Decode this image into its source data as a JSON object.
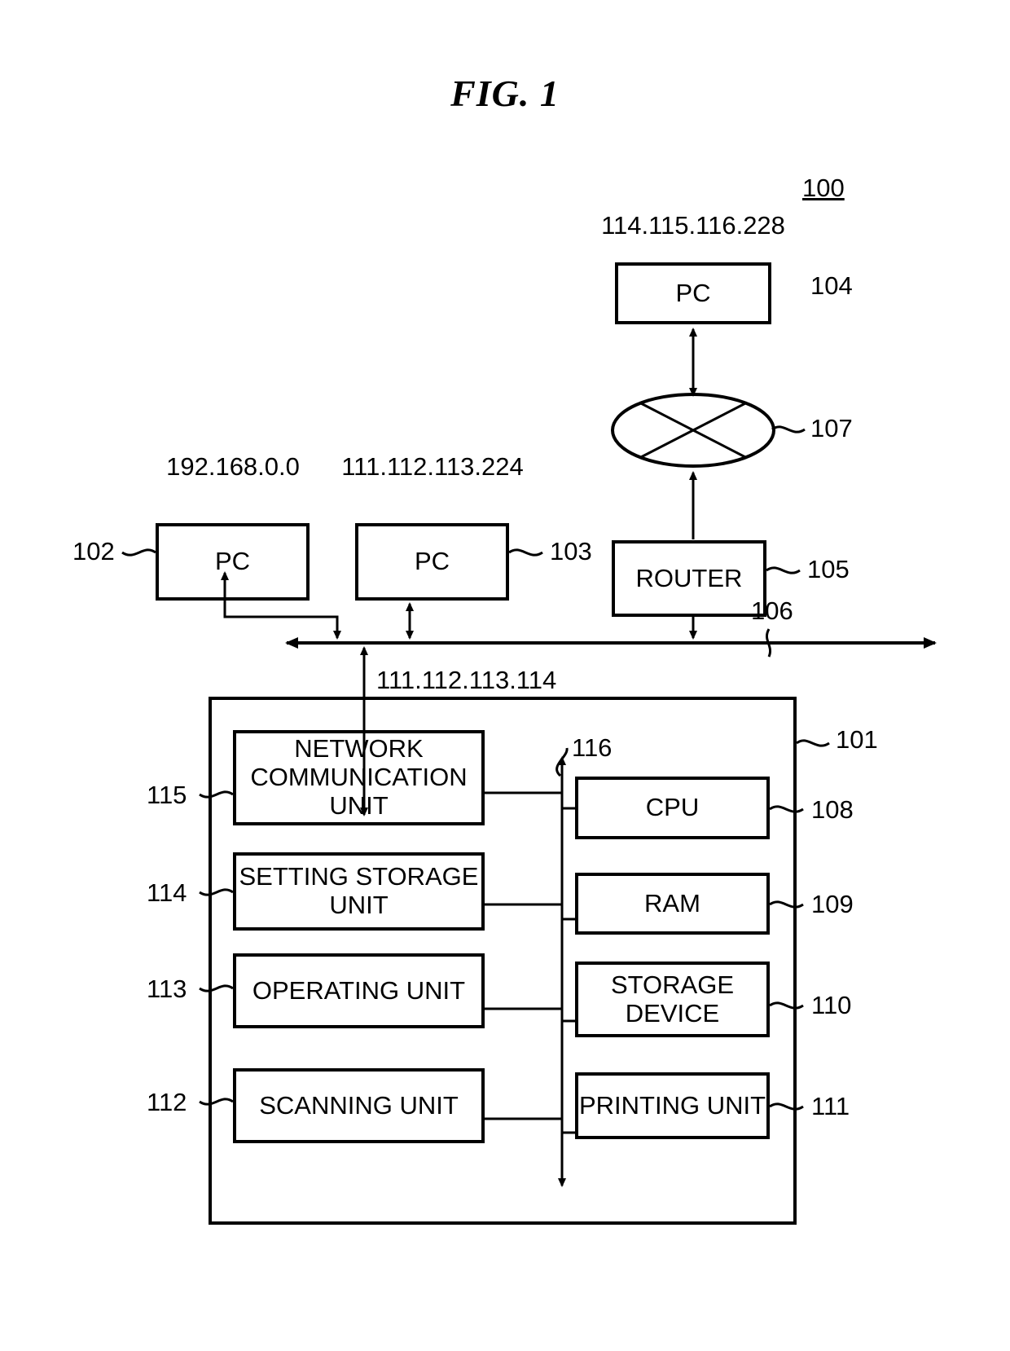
{
  "figure": {
    "title": "FIG. 1",
    "system_ref": "100"
  },
  "network": {
    "internet_cloud": {
      "ref": "107",
      "icon": "network-cloud-ellipse-x"
    },
    "bus": {
      "ref": "106",
      "icon": "bidirectional-bus-arrow"
    },
    "nodes": [
      {
        "id": "pc-104",
        "label": "PC",
        "ref": "104",
        "ip": "114.115.116.228"
      },
      {
        "id": "pc-102",
        "label": "PC",
        "ref": "102",
        "ip": "192.168.0.0"
      },
      {
        "id": "pc-103",
        "label": "PC",
        "ref": "103",
        "ip": "111.112.113.224"
      },
      {
        "id": "router-105",
        "label": "ROUTER",
        "ref": "105",
        "ip": ""
      }
    ]
  },
  "device": {
    "ref": "101",
    "ip": "111.112.113.114",
    "internal_bus": {
      "ref": "116",
      "icon": "internal-bus-arrow"
    },
    "left_units": [
      {
        "id": "network-communication-unit",
        "label": "NETWORK COMMUNICATION UNIT",
        "ref": "115"
      },
      {
        "id": "setting-storage-unit",
        "label": "SETTING STORAGE UNIT",
        "ref": "114"
      },
      {
        "id": "operating-unit",
        "label": "OPERATING UNIT",
        "ref": "113"
      },
      {
        "id": "scanning-unit",
        "label": "SCANNING UNIT",
        "ref": "112"
      }
    ],
    "right_units": [
      {
        "id": "cpu",
        "label": "CPU",
        "ref": "108"
      },
      {
        "id": "ram",
        "label": "RAM",
        "ref": "109"
      },
      {
        "id": "storage-device",
        "label": "STORAGE DEVICE",
        "ref": "110"
      },
      {
        "id": "printing-unit",
        "label": "PRINTING UNIT",
        "ref": "111"
      }
    ]
  },
  "colors": {
    "ink": "#000000",
    "paper": "#ffffff"
  }
}
